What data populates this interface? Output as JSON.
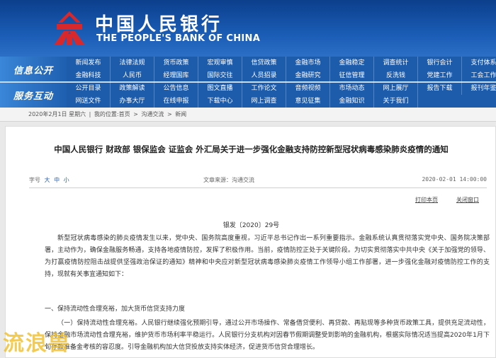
{
  "header": {
    "logo_cn": "中国人民银行",
    "logo_en": "THE PEOPLE'S BANK OF CHINA"
  },
  "nav": {
    "group1": "信息公开",
    "group2": "服务互动",
    "row1": [
      "新闻发布",
      "法律法规",
      "货币政策",
      "宏观审慎",
      "信贷政策",
      "金融市场",
      "金融稳定",
      "调查统计",
      "银行会计",
      "支付体系"
    ],
    "row2": [
      "金融科技",
      "人民币",
      "经理国库",
      "国际交往",
      "人员招录",
      "金融研究",
      "征信管理",
      "反洗钱",
      "党建工作",
      "工会工作"
    ],
    "row3": [
      "公开目录",
      "政策解读",
      "公告信息",
      "图文直播",
      "工作论文",
      "音频视频",
      "市场动态",
      "网上展厅",
      "报告下载",
      "报刊年鉴"
    ],
    "row4": [
      "网送文件",
      "办事大厅",
      "在线申报",
      "下载中心",
      "网上调查",
      "意见征集",
      "金融知识",
      "关于我们"
    ]
  },
  "breadcrumb": {
    "date": "2020年2月1日 星期六",
    "location": "我的位置:首页",
    "level2": "沟通交流",
    "level3": "新闻"
  },
  "article": {
    "title": "中国人民银行 财政部 银保监会 证监会 外汇局关于进一步强化金融支持防控新型冠状病毒感染肺炎疫情的通知",
    "font_size_label": "字号",
    "font_sizes": [
      "大",
      "中",
      "小"
    ],
    "source": "文章来源：沟通交流",
    "date": "2020-02-01 14:00:00",
    "print_label": "打印本页",
    "close_label": "关闭窗口",
    "doc_number": "银发〔2020〕29号",
    "paragraph1": "新型冠状病毒感染的肺炎疫情发生以来，党中央、国务院高度重视，习近平总书记作出一系列重要指示。金融系统认真贯彻落实党中央、国务院决策部署，主动作为，确保金融服务畅通，支持各地疫情防控，发挥了积极作用。当前，疫情防控正处于关键阶段。为切实贯彻落实中共中央《关于加强党的领导、为打赢疫情防控阻击战提供坚强政治保证的通知》精神和中央应对新型冠状病毒感染肺炎疫情工作领导小组工作部署，进一步强化金融对疫情防控工作的支持，现就有关事宜通知如下：",
    "section1": "一、保持流动性合理充裕，加大货币信贷支持力度",
    "paragraph2": "（一）保持流动性合理充裕。人民银行继续强化预期引导，通过公开市场操作、常备借贷便利、再贷款、再贴现等多种货币政策工具，提供充足流动性，保持金融市场流动性合理充裕，维护货币市场利率平稳运行。人民银行分支机构对因春节假期调整受到影响的金融机构，根据实际情况适当提高2020年1月下旬存款准备金考核的容忍度。引导金融机构加大信贷投放支持实体经济，促进货币信贷合理增长。"
  },
  "watermark": "流浪兽"
}
